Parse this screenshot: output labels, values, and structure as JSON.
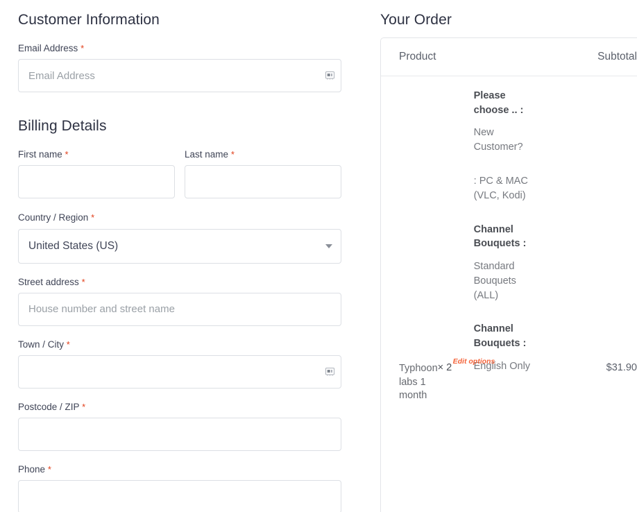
{
  "customer": {
    "heading": "Customer Information",
    "email": {
      "label": "Email Address",
      "required_mark": "*",
      "placeholder": "Email Address",
      "value": ""
    }
  },
  "billing": {
    "heading": "Billing Details",
    "first_name": {
      "label": "First name",
      "required_mark": "*",
      "value": ""
    },
    "last_name": {
      "label": "Last name",
      "required_mark": "*",
      "value": ""
    },
    "country": {
      "label": "Country / Region",
      "required_mark": "*",
      "selected": "United States (US)"
    },
    "street_address": {
      "label": "Street address",
      "required_mark": "*",
      "placeholder": "House number and street name",
      "value": ""
    },
    "town_city": {
      "label": "Town / City",
      "required_mark": "*",
      "value": ""
    },
    "postcode": {
      "label": "Postcode / ZIP",
      "required_mark": "*",
      "value": ""
    },
    "phone": {
      "label": "Phone",
      "required_mark": "*",
      "value": ""
    }
  },
  "order": {
    "heading": "Your Order",
    "columns": {
      "product": "Product",
      "subtotal": "Subtotal"
    },
    "item": {
      "name": "Typhoon labs 1 month",
      "quantity": "× 2",
      "edit_link": "Edit options",
      "price": "$31.90",
      "options": [
        {
          "title": "Please choose .. :",
          "value": "New Customer?"
        },
        {
          "title": "",
          "value": ":    PC & MAC (VLC, Kodi)"
        },
        {
          "title": "Channel Bouquets :",
          "value": "Standard Bouquets (ALL)"
        },
        {
          "title": "Channel Bouquets :",
          "value": "English Only"
        }
      ]
    }
  },
  "colors": {
    "heading": "#2d3142",
    "required": "#e2401c",
    "accent_orange": "#f4653c",
    "border": "#dcdfe4",
    "placeholder": "#9aa0a6"
  }
}
